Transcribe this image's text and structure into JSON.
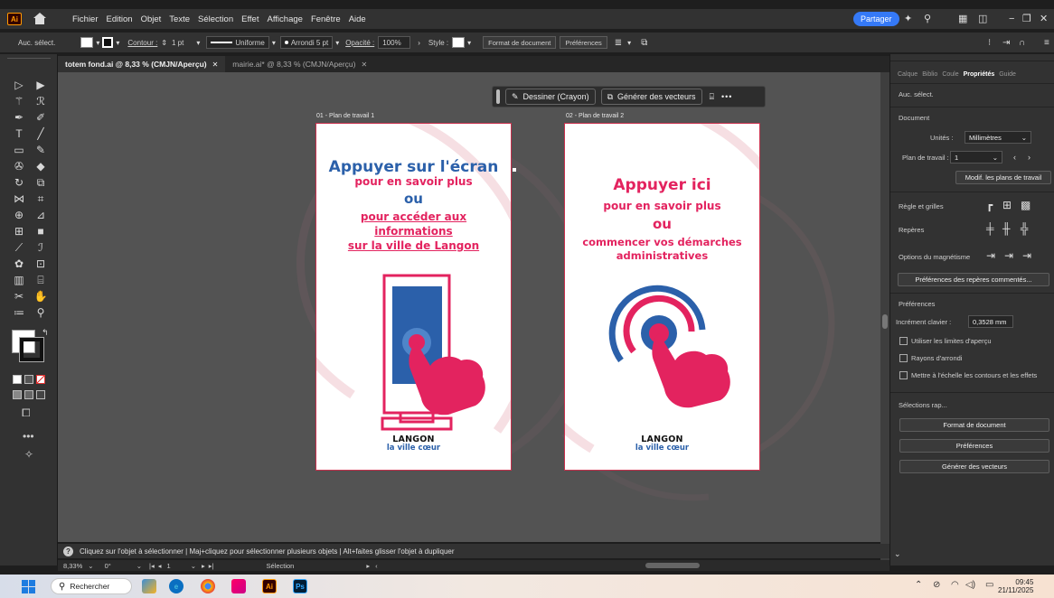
{
  "app": {
    "logo": "Ai",
    "accent": "#ff9a00"
  },
  "menubar": {
    "items": [
      "Fichier",
      "Edition",
      "Objet",
      "Texte",
      "Sélection",
      "Effet",
      "Affichage",
      "Fenêtre",
      "Aide"
    ],
    "share_label": "Partager"
  },
  "controlbar": {
    "selection_label": "Auc. sélect.",
    "contour_label": "Contour :",
    "contour_value": "1 pt",
    "profile_label": "Uniforme",
    "brush_label": "Arrondi 5 pt",
    "opacity_label": "Opacité :",
    "opacity_value": "100%",
    "style_label": "Style :",
    "doc_format_button": "Format de document",
    "preferences_button": "Préférences"
  },
  "tabs": [
    {
      "label": "totem fond.ai @ 8,33 % (CMJN/Aperçu)",
      "active": true
    },
    {
      "label": "mairie.ai* @ 8,33 % (CMJN/Aperçu)",
      "active": false
    }
  ],
  "context_bar": {
    "draw_button": "Dessiner (Crayon)",
    "vectors_button": "Générer des vecteurs",
    "more": "•••"
  },
  "artboards": [
    {
      "label": "01 - Plan de travail 1",
      "lines": [
        {
          "text": "Appuyer sur l'écran",
          "color": "blue"
        },
        {
          "text": "pour en savoir plus",
          "color": "pink"
        },
        {
          "text": "ou",
          "color": "blue"
        },
        {
          "text": "pour accéder aux",
          "color": "pink"
        },
        {
          "text": "informations",
          "color": "pink"
        },
        {
          "text": "sur la ville de Langon",
          "color": "pink"
        }
      ],
      "logo_top": "LANGON",
      "logo_bottom": "la ville cœur"
    },
    {
      "label": "02 - Plan de travail 2",
      "lines": [
        {
          "text": "Appuyer ici",
          "color": "pink"
        },
        {
          "text": "pour en savoir plus",
          "color": "pink"
        },
        {
          "text": "ou",
          "color": "pink"
        },
        {
          "text": "commencer vos démarches",
          "color": "pink"
        },
        {
          "text": "administratives",
          "color": "pink"
        }
      ],
      "logo_top": "LANGON",
      "logo_bottom": "la ville cœur"
    }
  ],
  "colors": {
    "brand_blue": "#2b60aa",
    "brand_pink": "#e3235f",
    "artboard_border": "#c8304d"
  },
  "right_panel": {
    "tabs": [
      "Calque",
      "Biblio",
      "Coule",
      "Propriétés",
      "Guide"
    ],
    "active_tab": "Propriétés",
    "selection": "Auc. sélect.",
    "document_title": "Document",
    "units_label": "Unités :",
    "units_value": "Millimètres",
    "artboard_label": "Plan de travail :",
    "artboard_value": "1",
    "edit_artboards_button": "Modif. les plans de travail",
    "rulers_label": "Règle et grilles",
    "guides_label": "Repères",
    "snap_label": "Options du magnétisme",
    "smart_guides_button": "Préférences des repères commentés...",
    "preferences_title": "Préférences",
    "keyboard_increment_label": "Incrément clavier :",
    "keyboard_increment_value": "0,3528 mm",
    "checkbox_preview_bounds": "Utiliser les limites d'aperçu",
    "checkbox_round_corners": "Rayons d'arrondi",
    "checkbox_scale_strokes": "Mettre à l'échelle les contours et les effets",
    "quick_actions_title": "Sélections rap...",
    "quick_doc_format": "Format de document",
    "quick_preferences": "Préférences",
    "quick_vectors": "Générer des vecteurs"
  },
  "statusbar": {
    "hint": "Cliquez sur l'objet à sélectionner  |  Maj+cliquez pour sélectionner plusieurs objets  |  Alt+faites glisser l'objet à dupliquer",
    "zoom": "8,33%",
    "rotation": "0°",
    "artboard_number": "1",
    "tool": "Sélection"
  },
  "taskbar": {
    "search_label": "Rechercher",
    "time": "09:45",
    "date": "21/11/2025"
  }
}
